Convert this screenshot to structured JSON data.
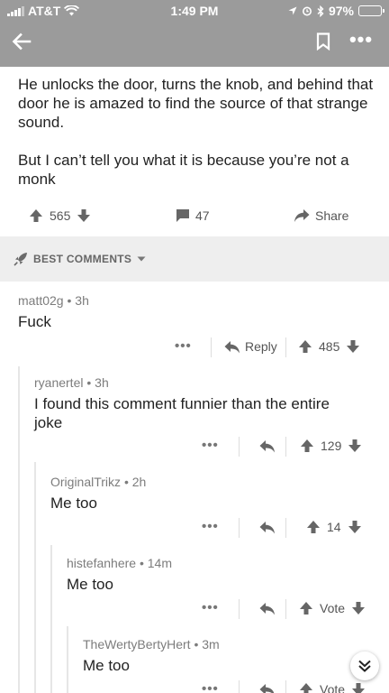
{
  "status_bar": {
    "carrier": "AT&T",
    "time": "1:49 PM",
    "battery": "97%",
    "battery_level": 0.97
  },
  "header": {
    "back_icon": "arrow-left-icon",
    "bookmark_icon": "bookmark-icon",
    "more_label": "•••"
  },
  "post": {
    "paragraphs": [
      "He unlocks the door, turns the knob, and behind that door he is amazed to find the source of that strange sound.",
      "But I can’t tell you what it is because you’re not a monk"
    ],
    "score": "565",
    "comment_count": "47",
    "share_label": "Share"
  },
  "sort_bar": {
    "label": "BEST COMMENTS"
  },
  "comments": [
    {
      "author": "matt02g",
      "age": "3h",
      "text": "Fuck",
      "reply_label": "Reply",
      "score": "485",
      "dots": "•••"
    },
    {
      "author": "ryanertel",
      "age": "3h",
      "text": "I found this comment funnier than the entire joke",
      "score": "129",
      "dots": "•••"
    },
    {
      "author": "OriginalTrikz",
      "age": "2h",
      "text": "Me too",
      "score": "14",
      "dots": "•••"
    },
    {
      "author": "histefanhere",
      "age": "14m",
      "text": "Me too",
      "score": "Vote",
      "dots": "•••"
    },
    {
      "author": "TheWertyBertyHert",
      "age": "3m",
      "text": "Me too",
      "score": "Vote",
      "dots": "•••"
    }
  ],
  "meta_sep": "•"
}
